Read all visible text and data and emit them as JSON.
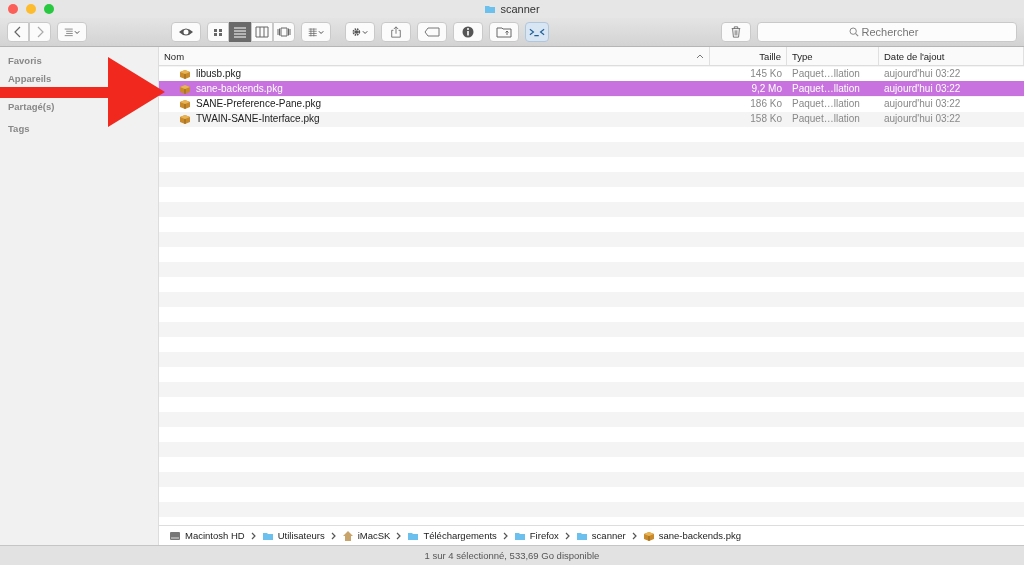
{
  "window": {
    "title": "scanner"
  },
  "toolbar": {
    "view_modes": [
      {
        "kind": "icons",
        "selected": false
      },
      {
        "kind": "list",
        "selected": true
      },
      {
        "kind": "columns",
        "selected": false
      },
      {
        "kind": "flow",
        "selected": false
      }
    ]
  },
  "search": {
    "placeholder": "Rechercher"
  },
  "sidebar": {
    "sections": [
      "Favoris",
      "Appareils",
      "Partagé(s)",
      "Tags"
    ]
  },
  "table": {
    "columns": [
      {
        "label": "Nom",
        "sorted": true
      },
      {
        "label": "Taille",
        "sorted": false
      },
      {
        "label": "Type",
        "sorted": false
      },
      {
        "label": "Date de l'ajout",
        "sorted": false
      }
    ],
    "rows": [
      {
        "name": "libusb.pkg",
        "size": "145 Ko",
        "type": "Paquet…llation",
        "date": "aujourd'hui 03:22",
        "selected": false
      },
      {
        "name": "sane-backends.pkg",
        "size": "9,2 Mo",
        "type": "Paquet…llation",
        "date": "aujourd'hui 03:22",
        "selected": true
      },
      {
        "name": "SANE-Preference-Pane.pkg",
        "size": "186 Ko",
        "type": "Paquet…llation",
        "date": "aujourd'hui 03:22",
        "selected": false
      },
      {
        "name": "TWAIN-SANE-Interface.pkg",
        "size": "158 Ko",
        "type": "Paquet…llation",
        "date": "aujourd'hui 03:22",
        "selected": false
      }
    ]
  },
  "path_bar": [
    {
      "label": "Macintosh HD",
      "kind": "disk"
    },
    {
      "label": "Utilisateurs",
      "kind": "folder"
    },
    {
      "label": "iMacSK",
      "kind": "home"
    },
    {
      "label": "Téléchargements",
      "kind": "folder"
    },
    {
      "label": "Firefox",
      "kind": "folder"
    },
    {
      "label": "scanner",
      "kind": "folder"
    },
    {
      "label": "sane-backends.pkg",
      "kind": "package"
    }
  ],
  "status_bar": "1 sur 4 sélectionné, 533,69 Go disponible",
  "annotation": {
    "kind": "arrow"
  }
}
